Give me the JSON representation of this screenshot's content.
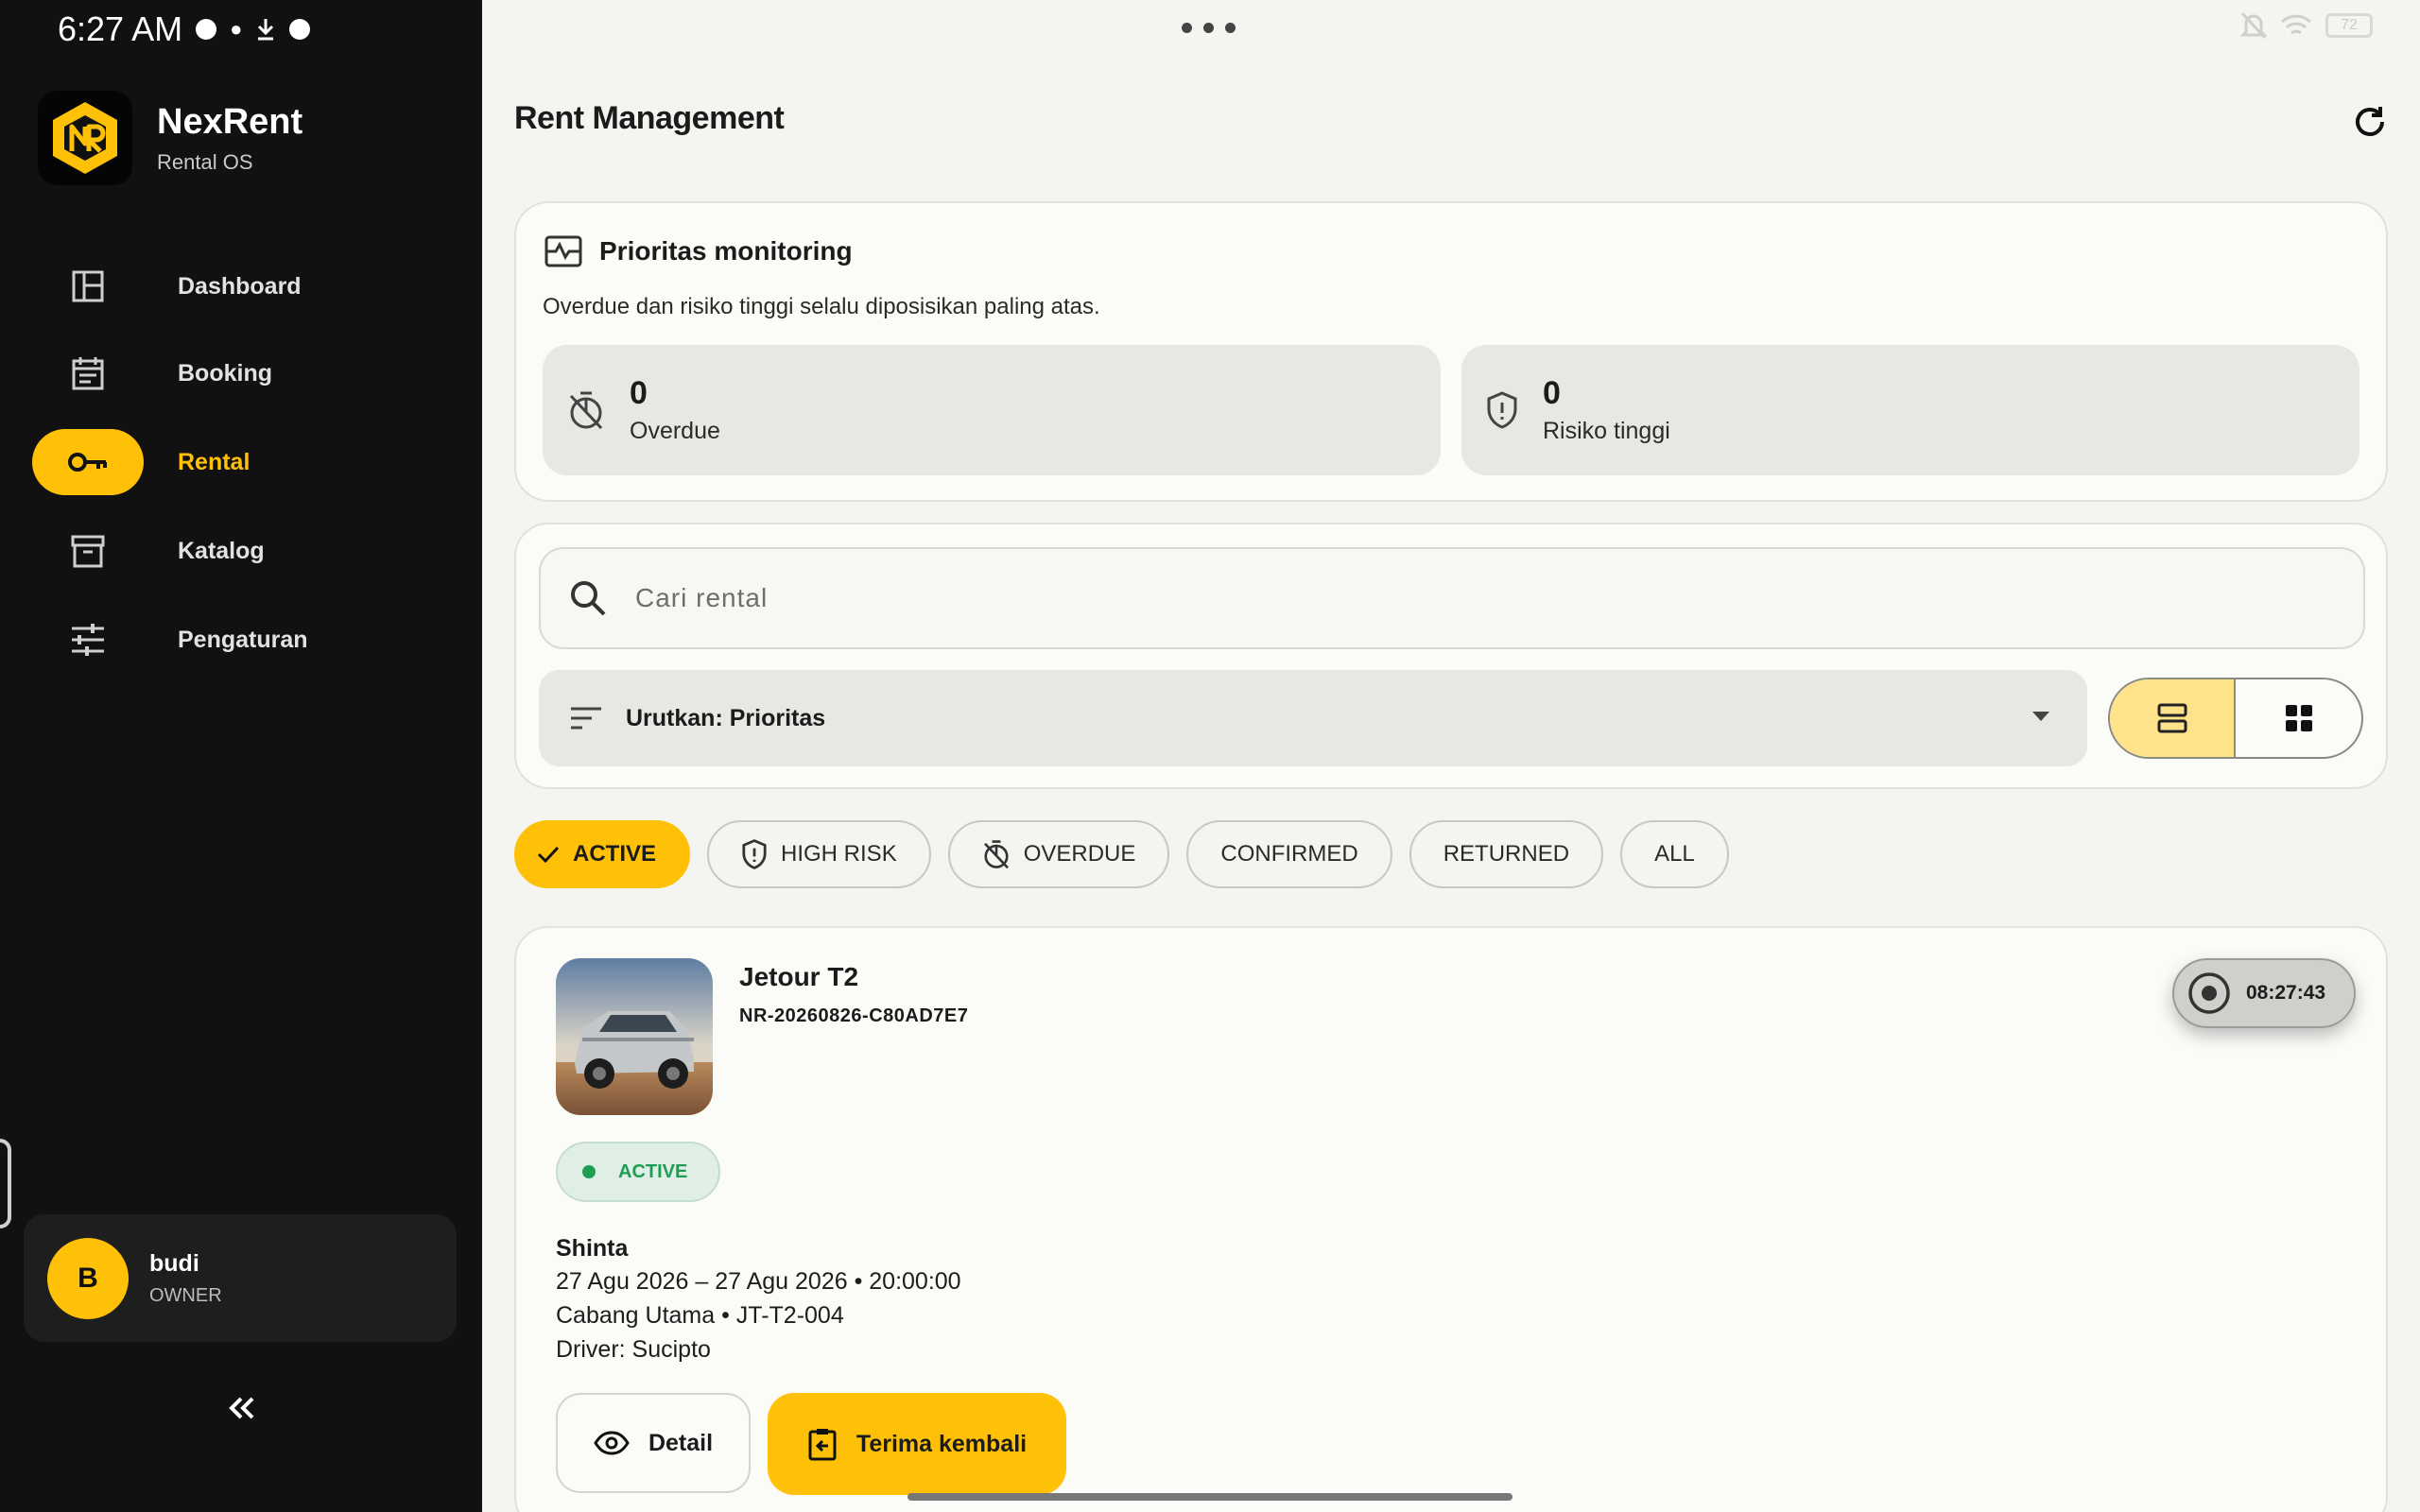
{
  "status_bar": {
    "time": "6:27 AM",
    "battery": "72"
  },
  "brand": {
    "name": "NexRent",
    "subtitle": "Rental OS"
  },
  "nav": [
    {
      "label": "Dashboard",
      "icon": "dashboard-icon"
    },
    {
      "label": "Booking",
      "icon": "calendar-icon"
    },
    {
      "label": "Rental",
      "icon": "key-icon",
      "active": true
    },
    {
      "label": "Katalog",
      "icon": "archive-icon"
    },
    {
      "label": "Pengaturan",
      "icon": "sliders-icon"
    }
  ],
  "user": {
    "initial": "B",
    "name": "budi",
    "role": "OWNER"
  },
  "page": {
    "title": "Rent Management"
  },
  "priority": {
    "title": "Prioritas monitoring",
    "description": "Overdue dan risiko tinggi selalu diposisikan paling atas.",
    "overdue": {
      "count": "0",
      "label": "Overdue"
    },
    "high_risk": {
      "count": "0",
      "label": "Risiko tinggi"
    }
  },
  "search": {
    "placeholder": "Cari rental"
  },
  "sort": {
    "label": "Urutkan: Prioritas"
  },
  "filters": [
    "ACTIVE",
    "HIGH RISK",
    "OVERDUE",
    "CONFIRMED",
    "RETURNED",
    "ALL"
  ],
  "active_filter": "ACTIVE",
  "rental": {
    "car_name": "Jetour T2",
    "code": "NR-20260826-C80AD7E7",
    "timer": "08:27:43",
    "status": "ACTIVE",
    "renter": "Shinta",
    "period": "27 Agu 2026 – 27 Agu 2026 • 20:00:00",
    "branch": "Cabang Utama • JT-T2-004",
    "driver": "Driver: Sucipto",
    "detail_label": "Detail",
    "return_label": "Terima kembali"
  },
  "colors": {
    "accent": "#ffc107",
    "sidebar": "#111111",
    "success": "#1f9d55"
  }
}
